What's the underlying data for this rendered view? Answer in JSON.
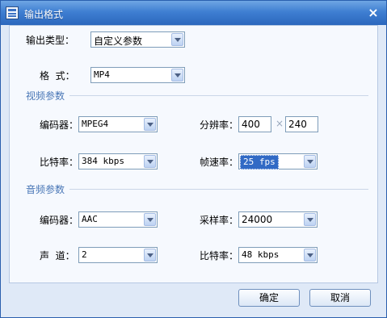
{
  "window": {
    "title": "输出格式",
    "close_glyph": "×"
  },
  "output_type": {
    "label": "输出类型：",
    "value": "自定义参数"
  },
  "format": {
    "label": "格  式：",
    "value": "MP4"
  },
  "video": {
    "section": "视频参数",
    "encoder": {
      "label": "编码器：",
      "value": "MPEG4"
    },
    "resolution": {
      "label": "分辨率：",
      "width": "400",
      "separator": "×",
      "height": "240"
    },
    "bitrate": {
      "label": "比特率：",
      "value": "384 kbps"
    },
    "framerate": {
      "label": "帧速率：",
      "value": "25 fps"
    }
  },
  "audio": {
    "section": "音频参数",
    "encoder": {
      "label": "编码器：",
      "value": "AAC"
    },
    "samplerate": {
      "label": "采样率：",
      "value": "24000"
    },
    "channels": {
      "label": "声  道：",
      "value": "2"
    },
    "bitrate": {
      "label": "比特率：",
      "value": "48 kbps"
    }
  },
  "buttons": {
    "ok": "确定",
    "cancel": "取消"
  }
}
